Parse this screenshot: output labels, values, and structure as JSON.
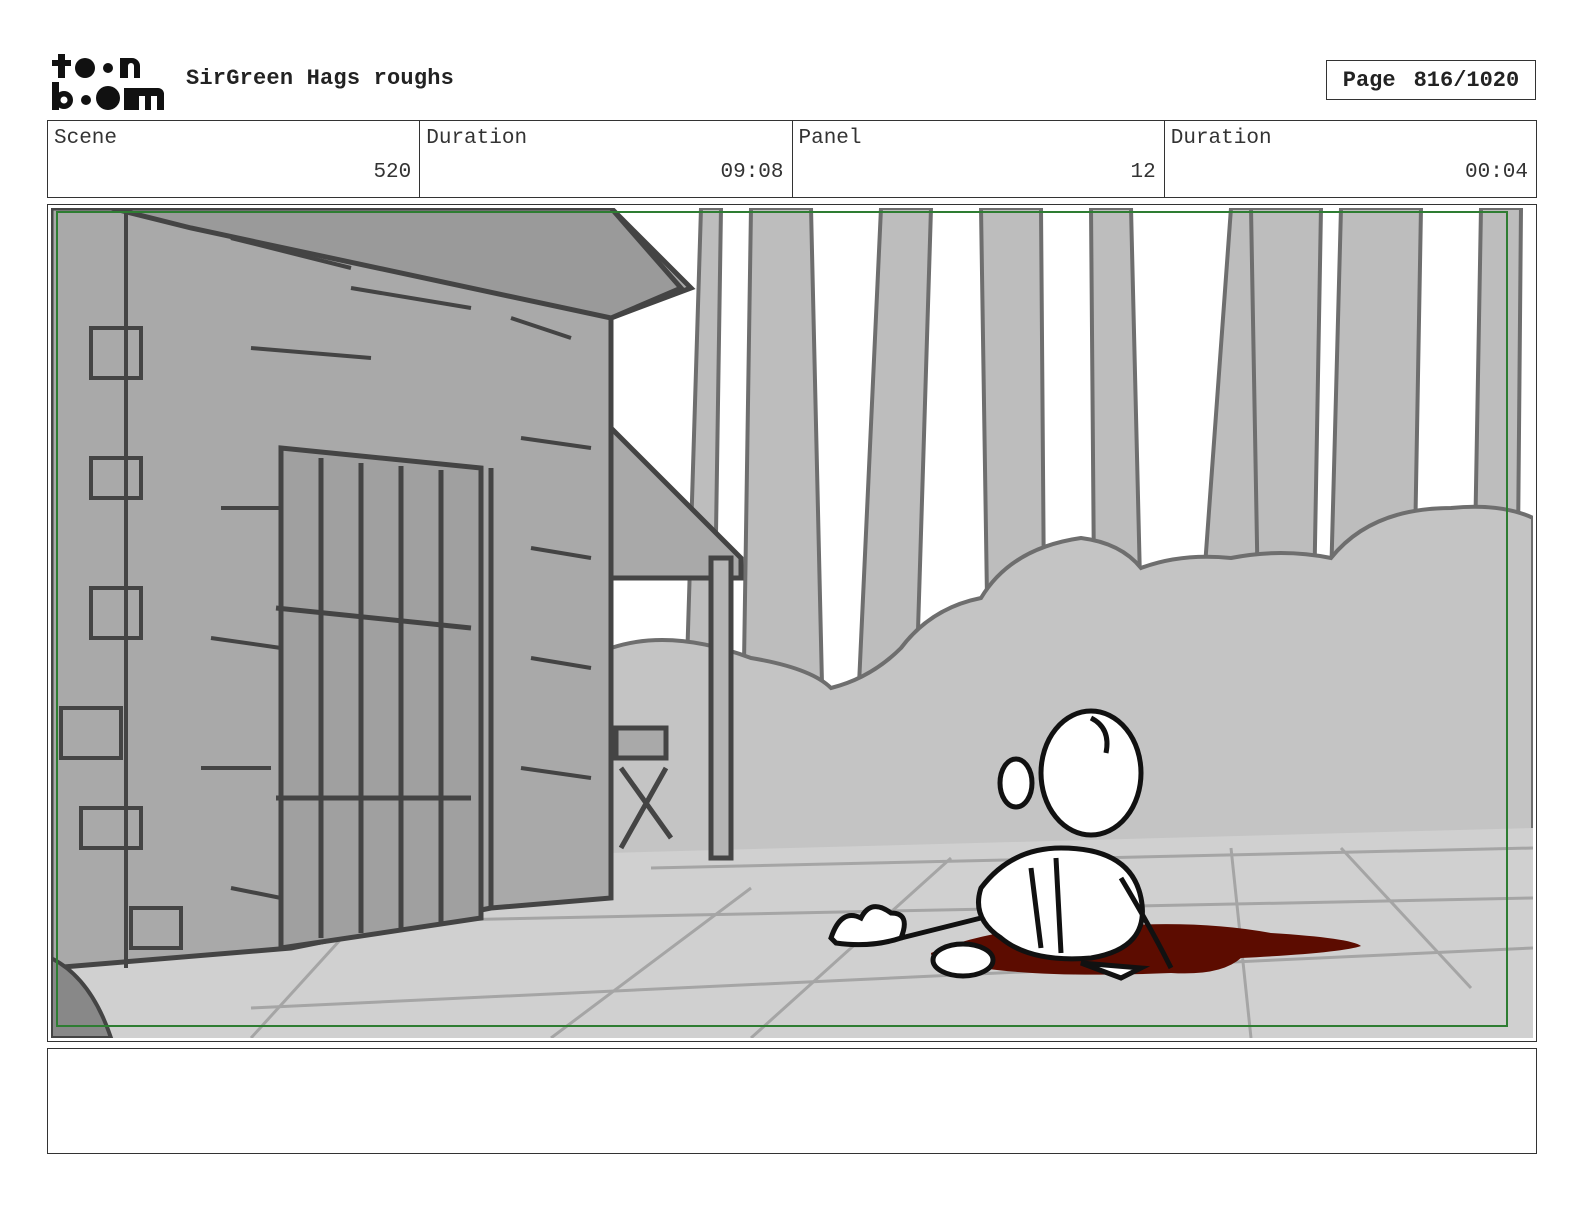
{
  "header": {
    "logo_text": "toon boom",
    "title": "SirGreen Hags roughs",
    "page_label": "Page",
    "page_number": "816/1020"
  },
  "info": {
    "scene_label": "Scene",
    "scene_value": "520",
    "scene_duration_label": "Duration",
    "scene_duration_value": "09:08",
    "panel_label": "Panel",
    "panel_value": "12",
    "panel_duration_label": "Duration",
    "panel_duration_value": "00:04"
  },
  "panel": {
    "description": "",
    "colors": {
      "frame_border": "#2e7d32",
      "blood": "#5c0c00",
      "stone": "#a9a9a9",
      "bushes": "#bdbdbd",
      "ground": "#cfcfcf"
    }
  },
  "notes": {
    "text": ""
  }
}
